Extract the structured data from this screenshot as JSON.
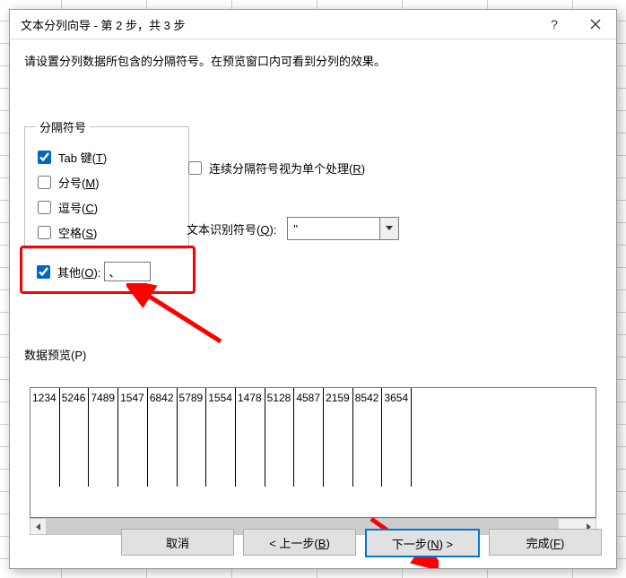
{
  "window": {
    "title": "文本分列向导 - 第 2 步，共 3 步",
    "help_symbol": "?"
  },
  "instructions": "请设置分列数据所包含的分隔符号。在预览窗口内可看到分列的效果。",
  "delimiters": {
    "group_label": "分隔符号",
    "tab": {
      "label": "Tab 键(T)",
      "checked": true
    },
    "semicolon": {
      "label": "分号(M)",
      "checked": false
    },
    "comma": {
      "label": "逗号(C)",
      "checked": false
    },
    "space": {
      "label": "空格(S)",
      "checked": false
    },
    "other": {
      "label": "其他(O):",
      "checked": true,
      "value": "、"
    }
  },
  "options": {
    "consecutive": {
      "label": "连续分隔符号视为单个处理(R)",
      "checked": false
    },
    "text_qualifier_label": "文本识别符号(Q):",
    "text_qualifier_value": "\""
  },
  "preview": {
    "label": "数据预览(P)",
    "columns": [
      "1234",
      "5246",
      "7489",
      "1547",
      "6842",
      "5789",
      "1554",
      "1478",
      "5128",
      "4587",
      "2159",
      "8542",
      "3654"
    ]
  },
  "buttons": {
    "cancel": "取消",
    "back": "< 上一步(B)",
    "next": "下一步(N) >",
    "finish": "完成(F)"
  }
}
